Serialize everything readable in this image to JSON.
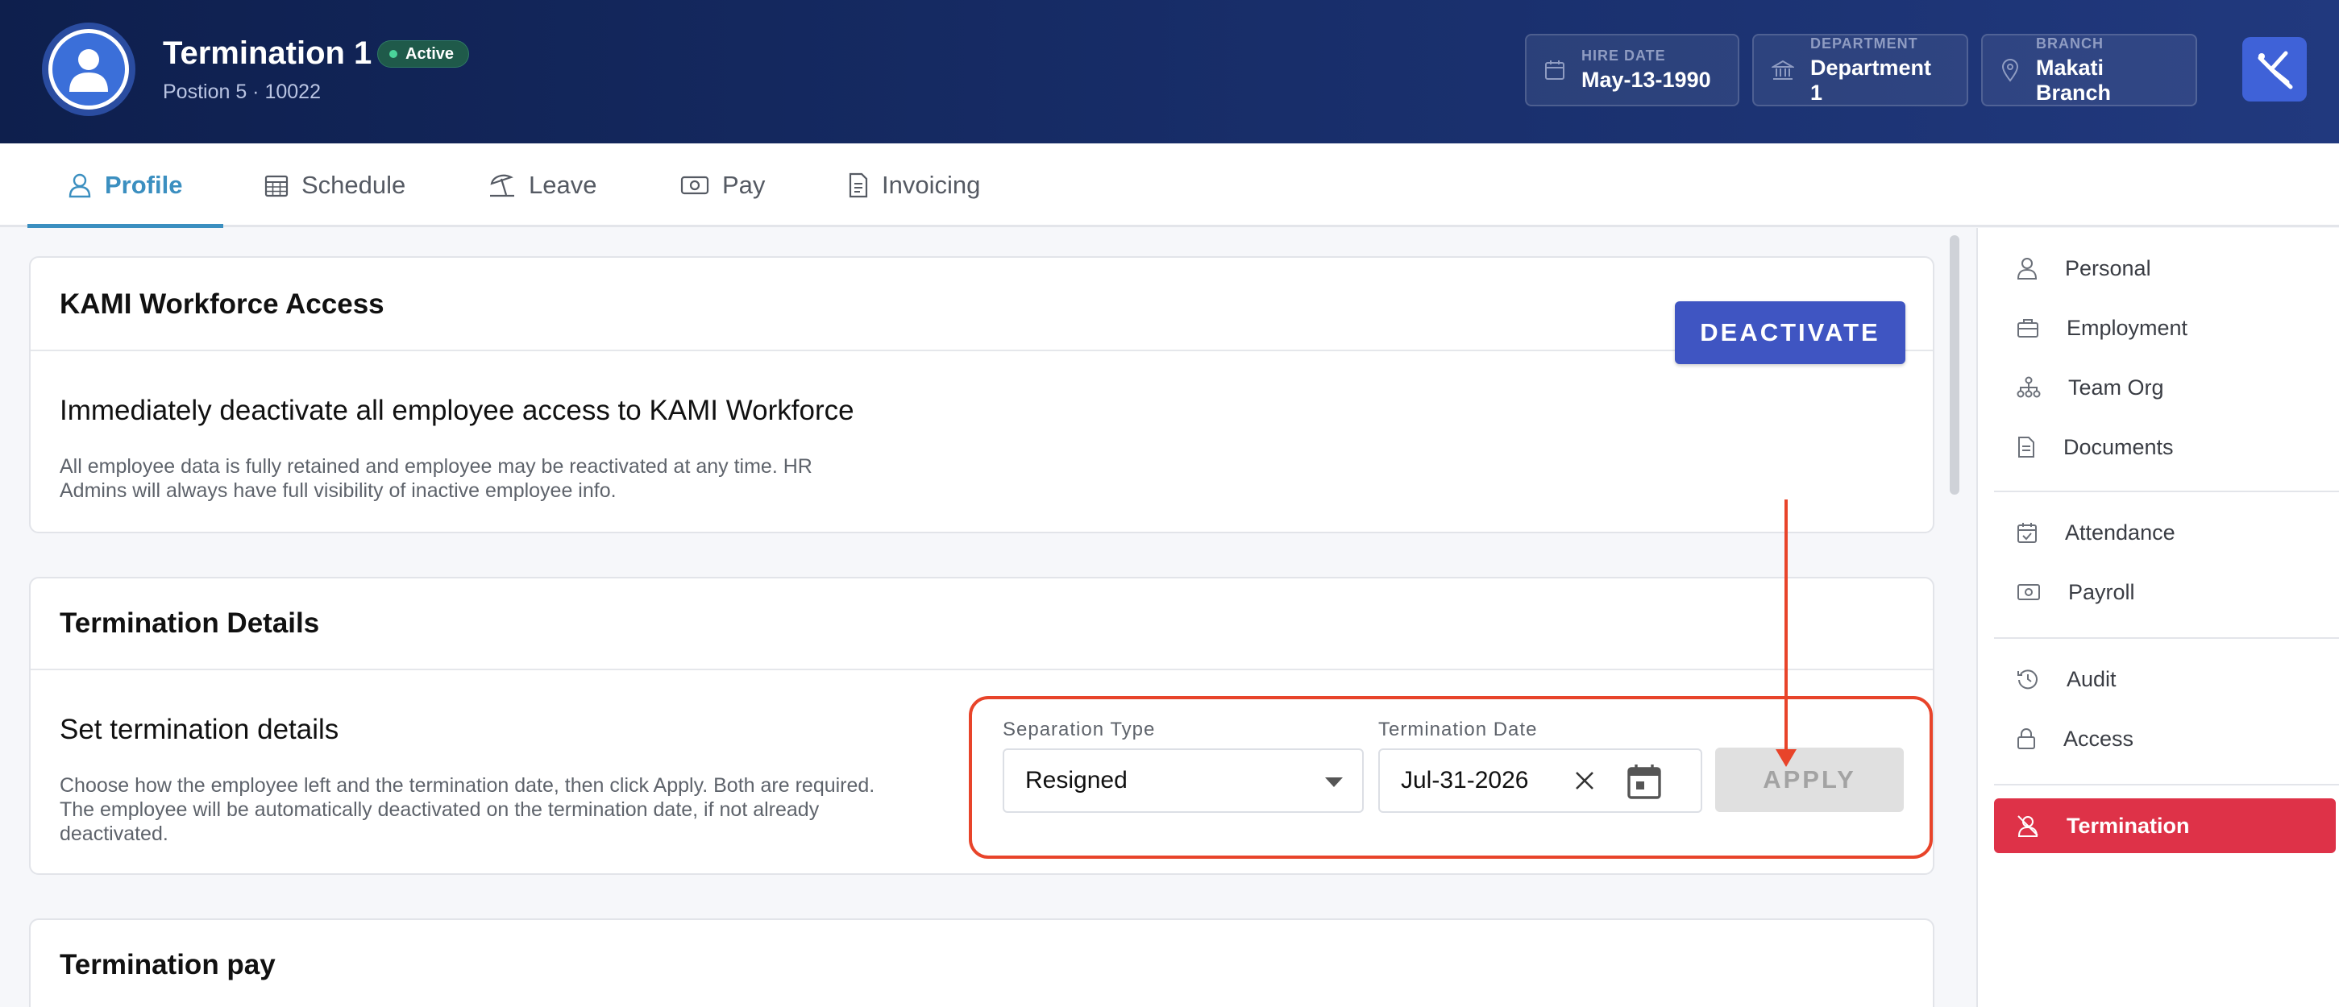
{
  "employee": {
    "name": "Termination 1",
    "status": "Active",
    "subtitle": "Postion 5 · 10022"
  },
  "info_cards": [
    {
      "label": "HIRE DATE",
      "value": "May-13-1990",
      "icon": "calendar-icon"
    },
    {
      "label": "DEPARTMENT",
      "value": "Department 1",
      "icon": "bank-icon"
    },
    {
      "label": "BRANCH",
      "value": "Makati Branch",
      "icon": "location-pin-icon"
    }
  ],
  "tabs": [
    {
      "label": "Profile",
      "icon": "user-icon",
      "active": true
    },
    {
      "label": "Schedule",
      "icon": "calendar-grid-icon"
    },
    {
      "label": "Leave",
      "icon": "beach-umbrella-icon"
    },
    {
      "label": "Pay",
      "icon": "money-icon"
    },
    {
      "label": "Invoicing",
      "icon": "invoice-icon"
    }
  ],
  "access_card": {
    "title": "KAMI Workforce Access",
    "heading": "Immediately deactivate all employee access to KAMI Workforce",
    "description_line1": "All employee data is fully retained and employee may be reactivated at any time. HR",
    "description_line2": "Admins will always have full visibility of inactive employee info.",
    "button_label": "DEACTIVATE"
  },
  "termination_card": {
    "title": "Termination Details",
    "heading": "Set termination details",
    "description_line1": "Choose how the employee left and the termination date, then click Apply. Both are required.",
    "description_line2": "The employee will be automatically deactivated on the termination date, if not already",
    "description_line3": "deactivated.",
    "separation_label": "Separation Type",
    "separation_value": "Resigned",
    "date_label": "Termination Date",
    "date_value": "Jul-31-2026",
    "apply_label": "APPLY"
  },
  "pay_card": {
    "title": "Termination pay"
  },
  "sidebar": {
    "items": [
      {
        "label": "Personal",
        "icon": "user-icon"
      },
      {
        "label": "Employment",
        "icon": "briefcase-icon"
      },
      {
        "label": "Team Org",
        "icon": "org-chart-icon"
      },
      {
        "label": "Documents",
        "icon": "document-icon"
      },
      {
        "label": "Attendance",
        "icon": "calendar-check-icon"
      },
      {
        "label": "Payroll",
        "icon": "money-icon"
      },
      {
        "label": "Audit",
        "icon": "history-icon"
      },
      {
        "label": "Access",
        "icon": "lock-icon"
      },
      {
        "label": "Termination",
        "icon": "user-off-icon",
        "active": true
      }
    ]
  },
  "colors": {
    "header_dark": "#0e1f4d",
    "accent_blue": "#3b8fc0",
    "deactivate_button": "#3f55c2",
    "termination_active": "#de3248",
    "highlight_red": "#e8442a"
  }
}
